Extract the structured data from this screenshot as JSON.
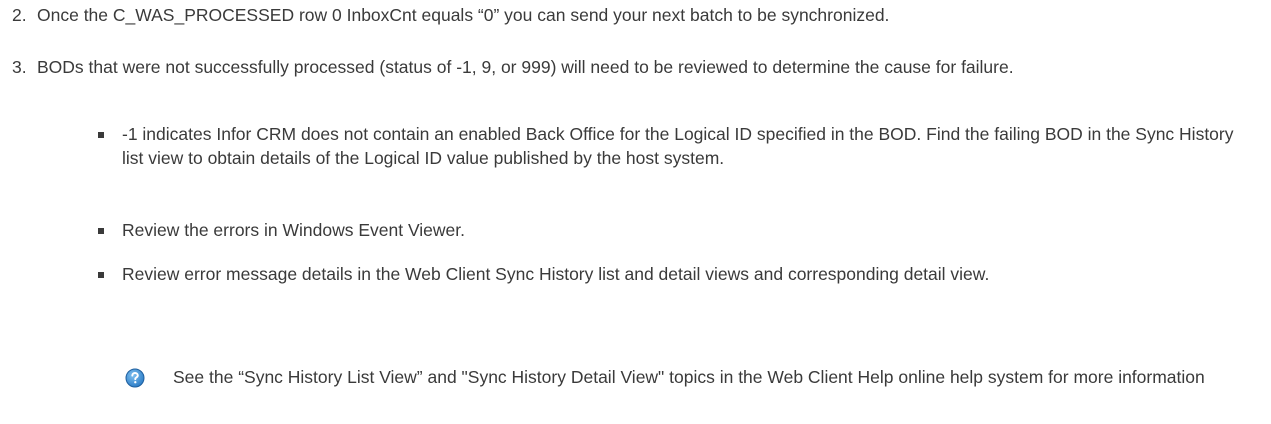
{
  "steps": [
    {
      "number": "2.",
      "text": "Once the C_WAS_PROCESSED row 0 InboxCnt equals “0” you can send your next batch to be synchronized."
    },
    {
      "number": "3.",
      "text": "BODs that were not successfully processed (status of -1, 9, or 999) will need to be reviewed to determine the cause for failure."
    }
  ],
  "bullets": [
    {
      "text": "-1 indicates Infor CRM does not contain an enabled Back Office for the Logical ID specified in the BOD. Find the failing BOD in the Sync History list view to obtain details of the Logical ID value published by the host system."
    },
    {
      "text": "Review the errors in Windows Event Viewer."
    },
    {
      "text": "Review error message details in the Web Client Sync History list and detail views and corresponding detail view."
    }
  ],
  "note": {
    "icon": "question-help-icon",
    "text": "See the “Sync History List View” and \"Sync History Detail View\" topics in the Web Client Help online help system for more information"
  },
  "colors": {
    "text": "#3a3a3a",
    "icon_fill": "#2f7fc8",
    "icon_border": "#1f5f9e"
  }
}
